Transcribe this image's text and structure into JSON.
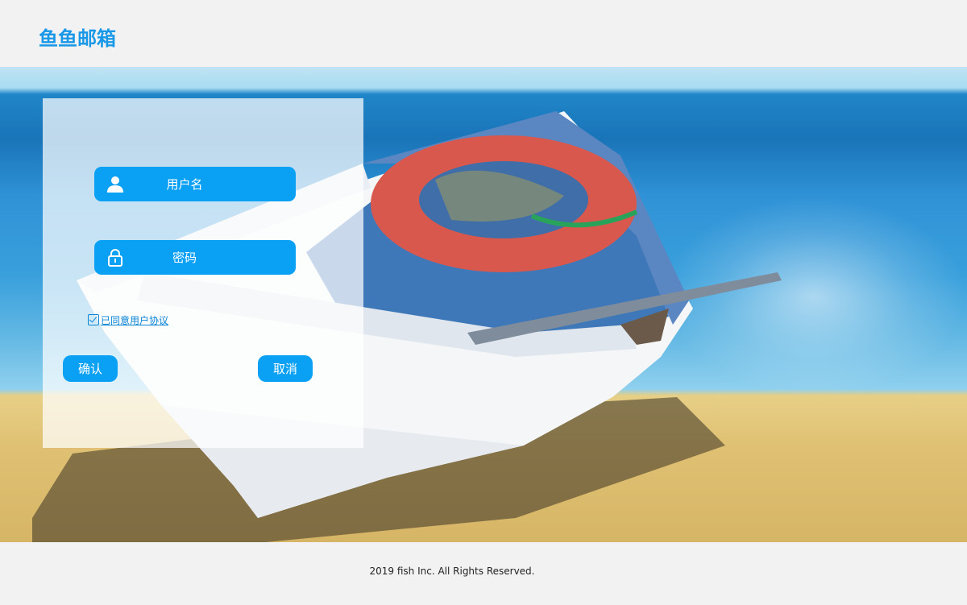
{
  "header": {
    "logo_text": "鱼鱼邮箱"
  },
  "login": {
    "username_placeholder": "用户名",
    "password_placeholder": "密码",
    "agree_label": "已同意用户协议",
    "confirm_label": "确认",
    "cancel_label": "取消",
    "agree_checked": true
  },
  "footer": {
    "copyright": "2019 fish Inc. All Rights Reserved."
  },
  "colors": {
    "accent": "#0aa0f4",
    "logo": "#1a98e8",
    "link": "#0a84d6",
    "background": "#f2f2f2"
  },
  "icons": [
    "user-icon",
    "lock-icon",
    "checkbox-checked-icon"
  ]
}
